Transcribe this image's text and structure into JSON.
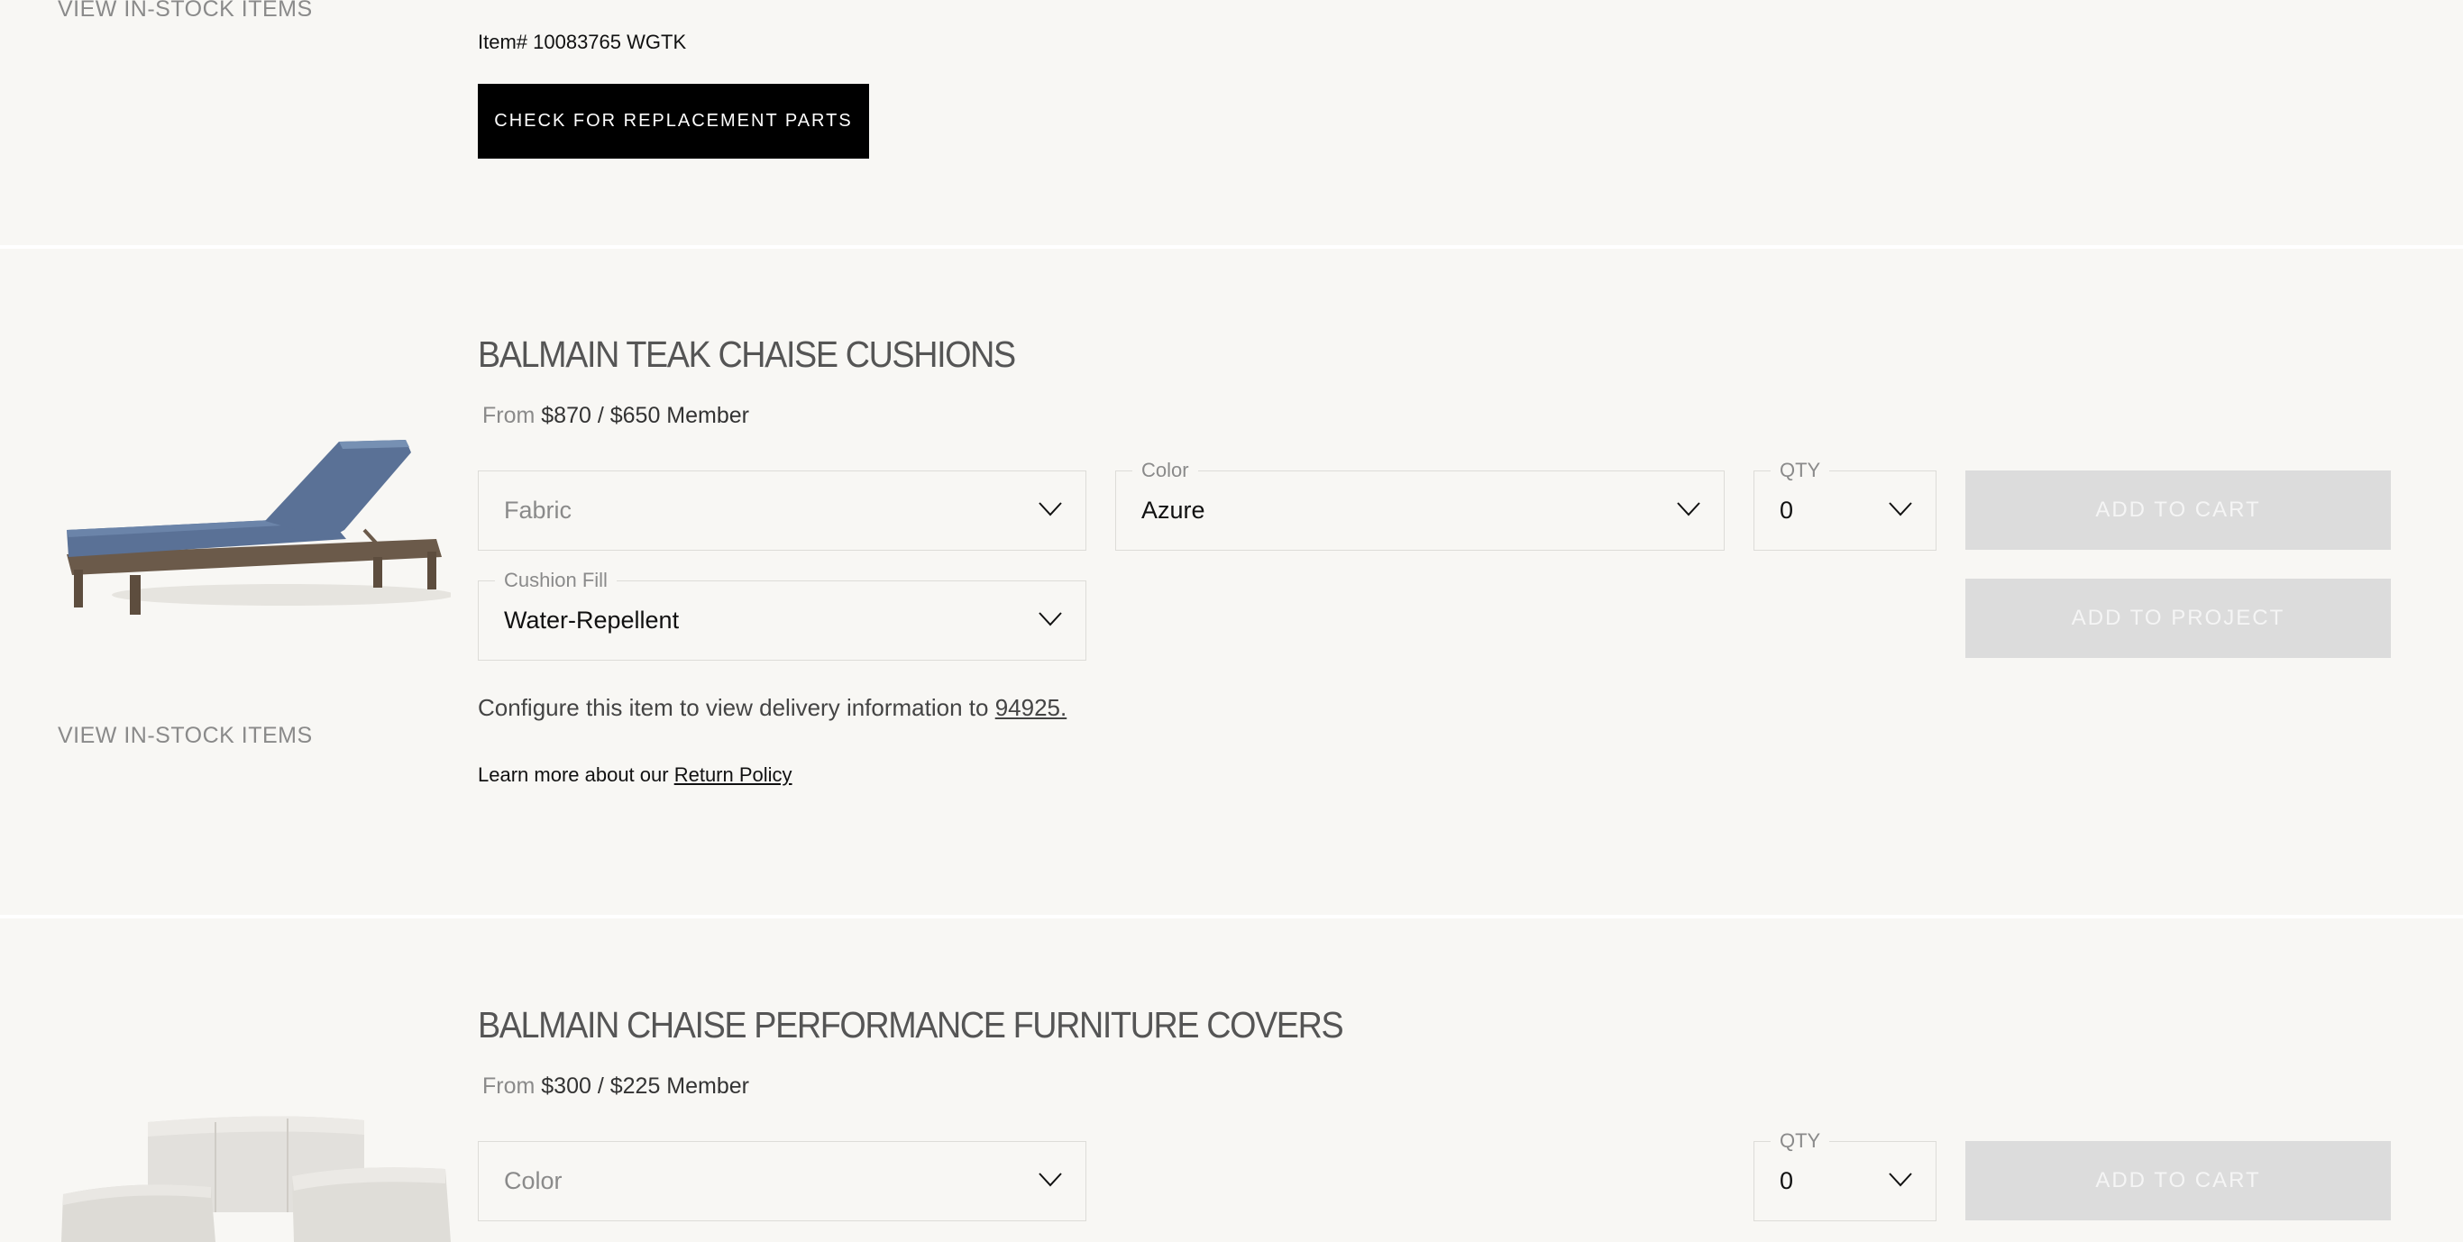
{
  "top_item": {
    "view_stock": "VIEW IN-STOCK ITEMS",
    "item_number": "Item# 10083765 WGTK",
    "replacement_button": "CHECK FOR REPLACEMENT PARTS"
  },
  "product1": {
    "title": "BALMAIN TEAK CHAISE CUSHIONS",
    "price_from": "From",
    "price": "$870 / $650 Member",
    "fabric": {
      "placeholder": "Fabric"
    },
    "color": {
      "label": "Color",
      "value": "Azure"
    },
    "qty": {
      "label": "QTY",
      "value": "0"
    },
    "cushion_fill": {
      "label": "Cushion Fill",
      "value": "Water-Repellent"
    },
    "add_to_cart": "ADD TO CART",
    "add_to_project": "ADD TO PROJECT",
    "delivery_text": "Configure this item to view delivery information to",
    "zip": "94925.",
    "policy_text": "Learn more about our",
    "policy_link": "Return Policy",
    "view_stock": "VIEW IN-STOCK ITEMS",
    "image_alt": "teak chaise lounge with blue cushion"
  },
  "product2": {
    "title": "BALMAIN CHAISE PERFORMANCE FURNITURE COVERS",
    "price_from": "From",
    "price": "$300 / $225 Member",
    "color": {
      "placeholder": "Color"
    },
    "qty": {
      "label": "QTY",
      "value": "0"
    },
    "add_to_cart": "ADD TO CART",
    "image_alt": "furniture covers"
  },
  "colors": {
    "background": "#f8f7f4",
    "black_button": "#000000",
    "disabled_button": "#dcdcdc",
    "cushion_blue": "#5a7196",
    "teak": "#6b5a4a"
  },
  "icons": {
    "chevron": "chevron-down-icon"
  }
}
